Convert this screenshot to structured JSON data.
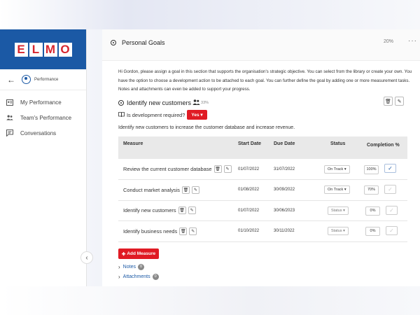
{
  "sidebar": {
    "logo_letters": [
      "E",
      "L",
      "M",
      "O"
    ],
    "back_label": "Performance",
    "items": [
      {
        "label": "My Performance",
        "icon": "id-card-icon"
      },
      {
        "label": "Team's Performance",
        "icon": "team-icon"
      },
      {
        "label": "Conversations",
        "icon": "chat-icon"
      }
    ]
  },
  "goal_section": {
    "title": "Personal Goals",
    "percent": "20%"
  },
  "intro": "Hi Gordon, please assign a goal in this section that supports the organisation's strategic objective. You can select from the library or create your own. You have the option to choose a development action to be attached to each goal. You can further define the goal by adding one or more measurement tasks. Notes and attachments can even be added to support your progress.",
  "goal": {
    "title": "Identify new customers",
    "percent": "33%",
    "dev_question": "Is development required?",
    "dev_answer": "Yes",
    "description": "Identify new customers to increase the customer database and increase revenue."
  },
  "table": {
    "headers": {
      "measure": "Measure",
      "start": "Start Date",
      "due": "Due Date",
      "status": "Status",
      "completion": "Completion %"
    },
    "rows": [
      {
        "name": "Review the current customer database",
        "start": "01/07/2022",
        "due": "31/07/2022",
        "status": "On Track",
        "completion": "100%",
        "checked": true
      },
      {
        "name": "Conduct market analysis",
        "start": "01/08/2022",
        "due": "30/09/2022",
        "status": "On Track",
        "completion": "70%",
        "checked": false
      },
      {
        "name": "Identify new customers",
        "start": "01/07/2022",
        "due": "30/06/2023",
        "status": "Status",
        "completion": "0%",
        "checked": false
      },
      {
        "name": "Identify business needs",
        "start": "01/10/2022",
        "due": "30/11/2022",
        "status": "Status",
        "completion": "0%",
        "checked": false
      }
    ]
  },
  "actions": {
    "add_measure": "Add Measure",
    "notes_label": "Notes",
    "notes_count": "0",
    "attachments_label": "Attachments",
    "attachments_count": "0"
  },
  "colors": {
    "brand_blue": "#1b59a5",
    "accent_red": "#e01b24"
  }
}
